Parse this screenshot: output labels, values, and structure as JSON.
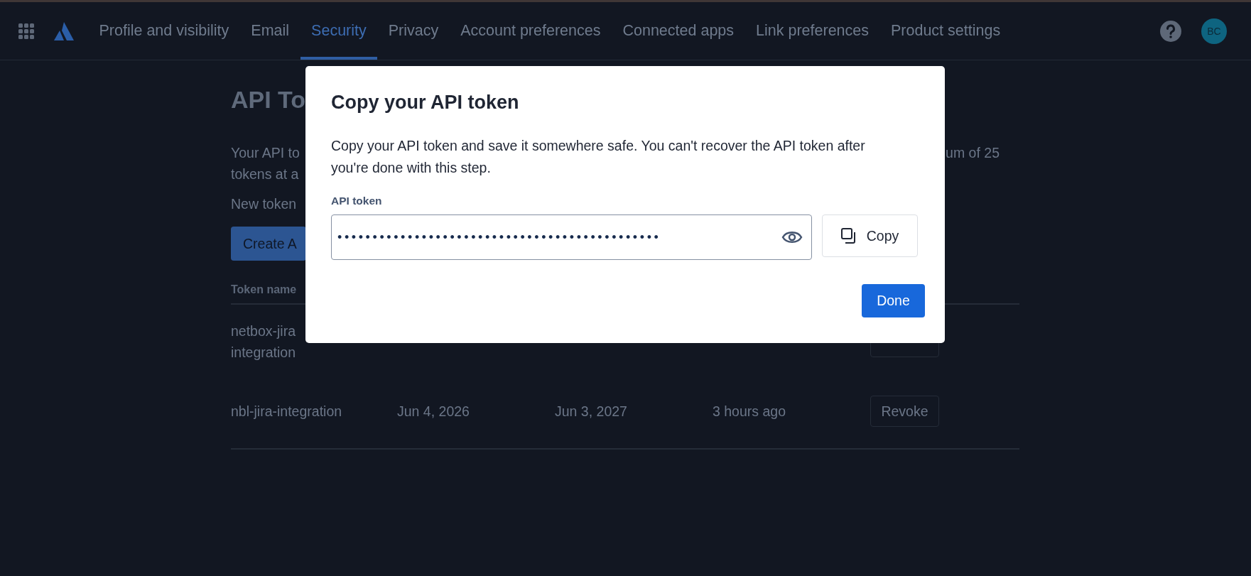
{
  "nav": {
    "tabs": [
      {
        "label": "Profile and visibility",
        "selected": false
      },
      {
        "label": "Email",
        "selected": false
      },
      {
        "label": "Security",
        "selected": true
      },
      {
        "label": "Privacy",
        "selected": false
      },
      {
        "label": "Account preferences",
        "selected": false
      },
      {
        "label": "Connected apps",
        "selected": false
      },
      {
        "label": "Link preferences",
        "selected": false
      },
      {
        "label": "Product settings",
        "selected": false
      }
    ],
    "avatar": "BC"
  },
  "page": {
    "title": "API To",
    "description_lines": [
      "Your API to",
      "tokens at a"
    ],
    "description_right": "um of 25",
    "note": "New token",
    "create_button": "Create A",
    "table": {
      "columns": [
        "Token name"
      ],
      "rows": [
        {
          "name_lines": [
            "netbox-jira",
            "integration"
          ],
          "cells": []
        },
        {
          "name_lines": [
            "nbl-jira-integration"
          ],
          "cells": [
            "Jun 4, 2026",
            "Jun 3, 2027",
            "3 hours ago"
          ],
          "action": "Revoke"
        }
      ]
    }
  },
  "dialog": {
    "title": "Copy your API token",
    "message": "Copy your API token and save it somewhere safe. You can't recover the API token after you're done with this step.",
    "field_label": "API token",
    "masked_value": "••••••••••••••••••••••••••••••••••••••••••••••",
    "copy_button": "Copy",
    "done_button": "Done"
  }
}
